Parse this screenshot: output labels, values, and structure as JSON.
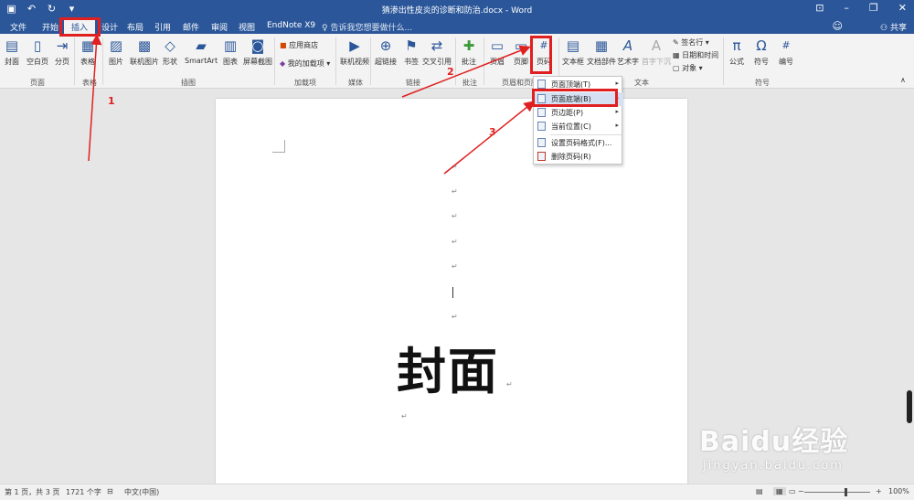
{
  "window": {
    "title": "猜渗出性皮炎的诊断和防治.docx - Word",
    "qat_icons": [
      "save-icon",
      "undo-icon",
      "redo-icon",
      "customize-icon"
    ],
    "controls": [
      "minimize-icon",
      "restore-icon",
      "close-icon"
    ]
  },
  "tabs": {
    "file": "文件",
    "home": "开始",
    "insert": "插入",
    "design": "设计",
    "layout": "布局",
    "references": "引用",
    "mailings": "邮件",
    "review": "审阅",
    "view": "视图",
    "endnote": "EndNote X9",
    "tell_me": "告诉我您想要做什么...",
    "share": "共享"
  },
  "ribbon": {
    "pages": {
      "cover": "封面",
      "blank": "空白页",
      "break": "分页",
      "label": "页面"
    },
    "tables": {
      "table": "表格",
      "label": "表格"
    },
    "illustrations": {
      "picture": "图片",
      "online_picture": "联机图片",
      "shapes": "形状",
      "smartart": "SmartArt",
      "chart": "图表",
      "screenshot": "屏幕截图",
      "label": "插图"
    },
    "addins": {
      "store": "应用商店",
      "my_addins": "我的加载项",
      "label": "加载项"
    },
    "media": {
      "online_video": "联机视频",
      "label": "媒体"
    },
    "links": {
      "hyperlink": "超链接",
      "bookmark": "书签",
      "cross_ref": "交叉引用",
      "label": "链接"
    },
    "comments": {
      "comment": "批注",
      "label": "批注"
    },
    "header_footer": {
      "header": "页眉",
      "footer": "页脚",
      "page_number": "页码",
      "label": "页眉和页脚"
    },
    "text": {
      "textbox": "文本框",
      "quick_parts": "文档部件",
      "wordart": "艺术字",
      "dropcap": "首字下沉",
      "signature": "签名行",
      "datetime": "日期和时间",
      "object": "对象",
      "label": "文本"
    },
    "symbols": {
      "equation": "公式",
      "symbol": "符号",
      "number": "编号",
      "label": "符号"
    }
  },
  "dropdown": {
    "items": [
      "页面顶端(T)",
      "页面底端(B)",
      "页边距(P)",
      "当前位置(C)",
      "设置页码格式(F)...",
      "删除页码(R)"
    ]
  },
  "document": {
    "cover_text": "封面",
    "para_mark": "↵"
  },
  "annotations": {
    "n1": "1",
    "n2": "2",
    "n3": "3",
    "color": "#e02020"
  },
  "status": {
    "page": "第 1 页，共 3 页",
    "words": "1721 个字",
    "language": "中文(中国)",
    "zoom": "100%"
  },
  "watermark": {
    "logo": "Baidu经验",
    "url": "jingyan.baidu.com"
  }
}
